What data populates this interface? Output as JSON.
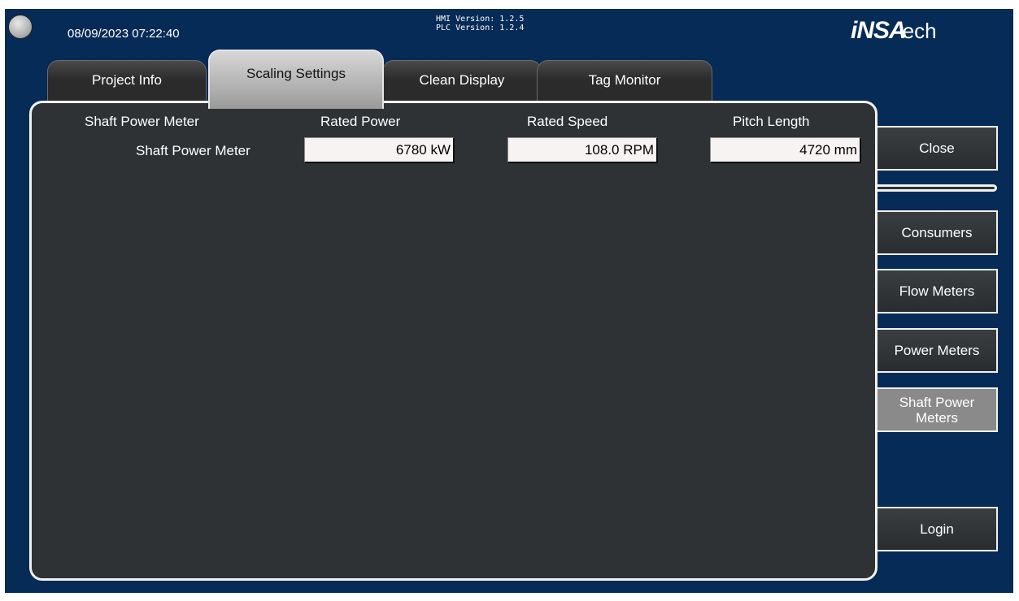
{
  "header": {
    "datetime": "08/09/2023 07:22:40",
    "hmi_version": "HMI Version: 1.2.5",
    "plc_version": "PLC Version: 1.2.4",
    "brand_main": "iNSA",
    "brand_suffix": "ech"
  },
  "tabs": [
    {
      "label": "Project Info"
    },
    {
      "label": "Scaling Settings",
      "active": true
    },
    {
      "label": "Clean Display"
    },
    {
      "label": "Tag Monitor"
    }
  ],
  "table": {
    "headers": [
      "Shaft Power Meter",
      "Rated Power",
      "Rated Speed",
      "Pitch Length"
    ],
    "row": {
      "label": "Shaft Power Meter",
      "rated_power": "6780 kW",
      "rated_speed": "108.0 RPM",
      "pitch_length": "4720 mm"
    }
  },
  "sidebar": {
    "close": "Close",
    "consumers": "Consumers",
    "flow_meters": "Flow Meters",
    "power_meters": "Power Meters",
    "shaft_power_meters": "Shaft Power Meters",
    "login": "Login"
  }
}
